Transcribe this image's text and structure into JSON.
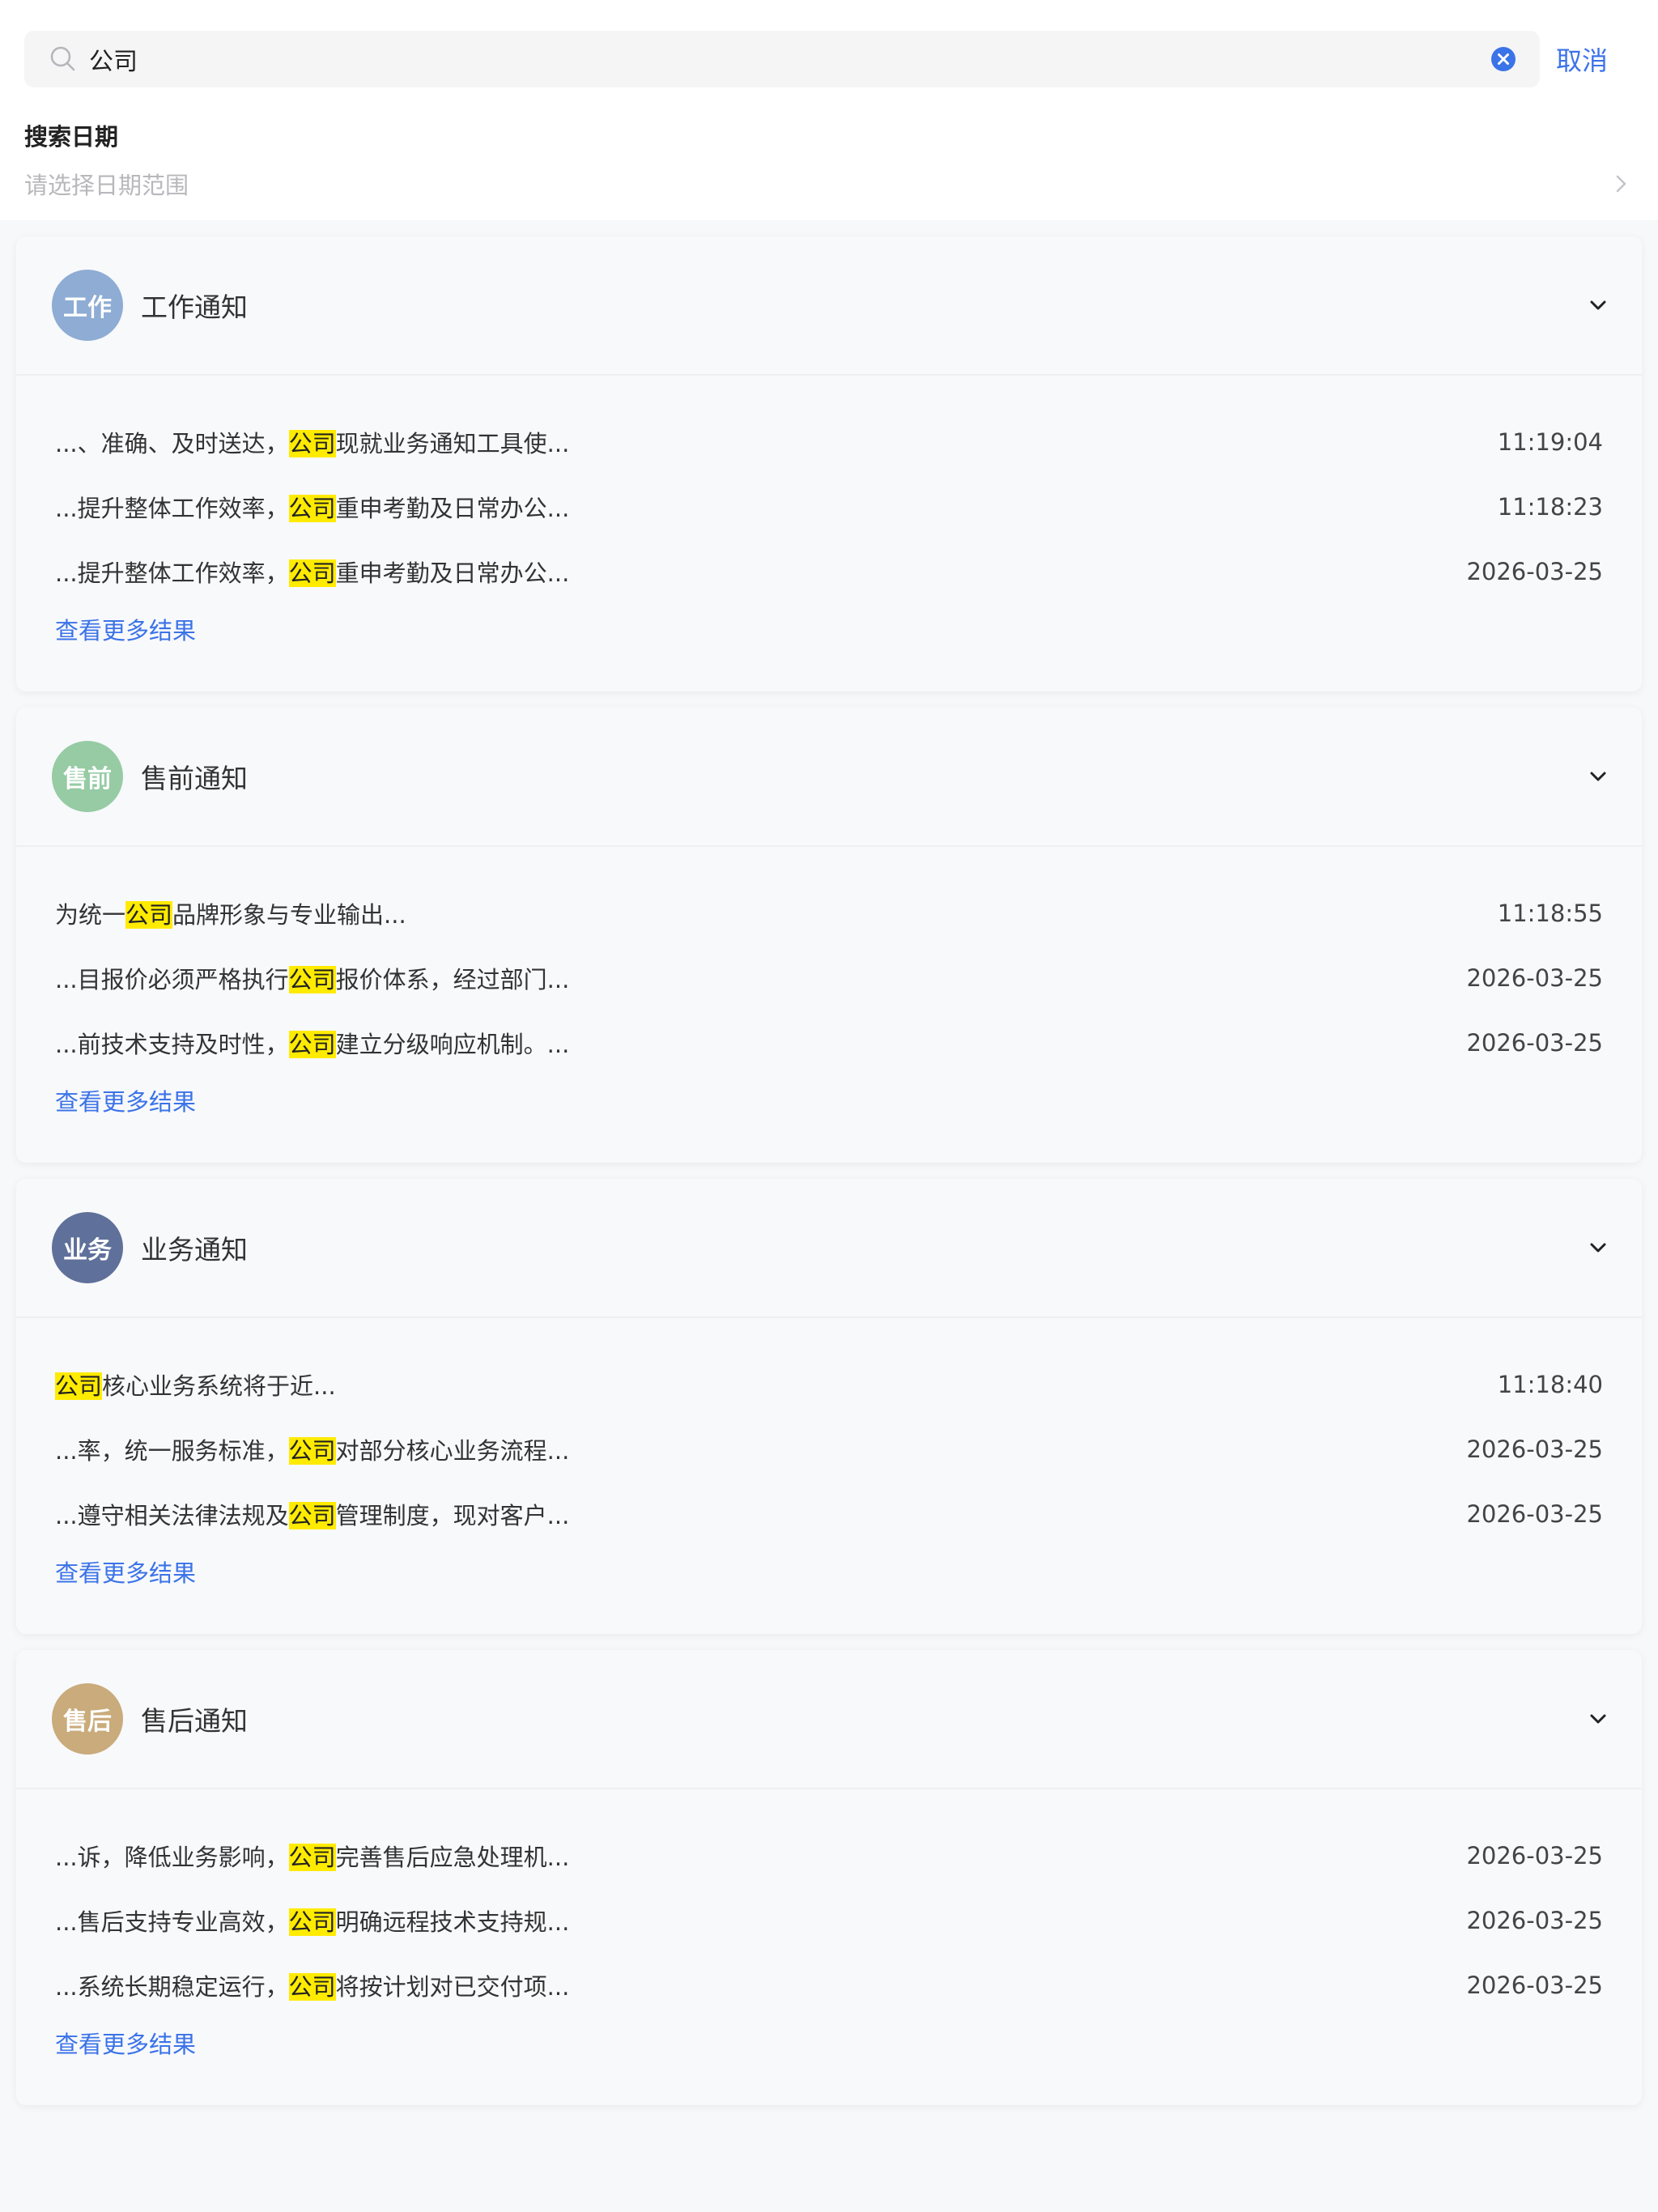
{
  "search": {
    "value": "公司",
    "placeholder": "",
    "cancel_label": "取消"
  },
  "date_filter": {
    "title": "搜索日期",
    "placeholder": "请选择日期范围"
  },
  "colors": {
    "accent": "#3b73e8",
    "highlight": "#ffeb00"
  },
  "groups": [
    {
      "avatar": "工作",
      "avatar_color": "#8eacd4",
      "title": "工作通知",
      "more": "查看更多结果",
      "results": [
        {
          "pre": "...、准确、及时送达，",
          "hit": "公司",
          "post": "现就业务通知工具使...",
          "time": "11:19:04"
        },
        {
          "pre": "...提升整体工作效率，",
          "hit": "公司",
          "post": "重申考勤及日常办公...",
          "time": "11:18:23"
        },
        {
          "pre": "...提升整体工作效率，",
          "hit": "公司",
          "post": "重申考勤及日常办公...",
          "time": "2026-03-25"
        }
      ]
    },
    {
      "avatar": "售前",
      "avatar_color": "#96cba4",
      "title": "售前通知",
      "more": "查看更多结果",
      "results": [
        {
          "pre": "为统一",
          "hit": "公司",
          "post": "品牌形象与专业输出...",
          "time": "11:18:55"
        },
        {
          "pre": "...目报价必须严格执行",
          "hit": "公司",
          "post": "报价体系，经过部门...",
          "time": "2026-03-25"
        },
        {
          "pre": "...前技术支持及时性，",
          "hit": "公司",
          "post": "建立分级响应机制。...",
          "time": "2026-03-25"
        }
      ]
    },
    {
      "avatar": "业务",
      "avatar_color": "#5f709a",
      "title": "业务通知",
      "more": "查看更多结果",
      "results": [
        {
          "pre": "",
          "hit": "公司",
          "post": "核心业务系统将于近...",
          "time": "11:18:40"
        },
        {
          "pre": "...率，统一服务标准，",
          "hit": "公司",
          "post": "对部分核心业务流程...",
          "time": "2026-03-25"
        },
        {
          "pre": "...遵守相关法律法规及",
          "hit": "公司",
          "post": "管理制度，现对客户...",
          "time": "2026-03-25"
        }
      ]
    },
    {
      "avatar": "售后",
      "avatar_color": "#c9ab7c",
      "title": "售后通知",
      "more": "查看更多结果",
      "results": [
        {
          "pre": "...诉，降低业务影响，",
          "hit": "公司",
          "post": "完善售后应急处理机...",
          "time": "2026-03-25"
        },
        {
          "pre": "...售后支持专业高效，",
          "hit": "公司",
          "post": "明确远程技术支持规...",
          "time": "2026-03-25"
        },
        {
          "pre": "...系统长期稳定运行，",
          "hit": "公司",
          "post": "将按计划对已交付项...",
          "time": "2026-03-25"
        }
      ]
    }
  ]
}
